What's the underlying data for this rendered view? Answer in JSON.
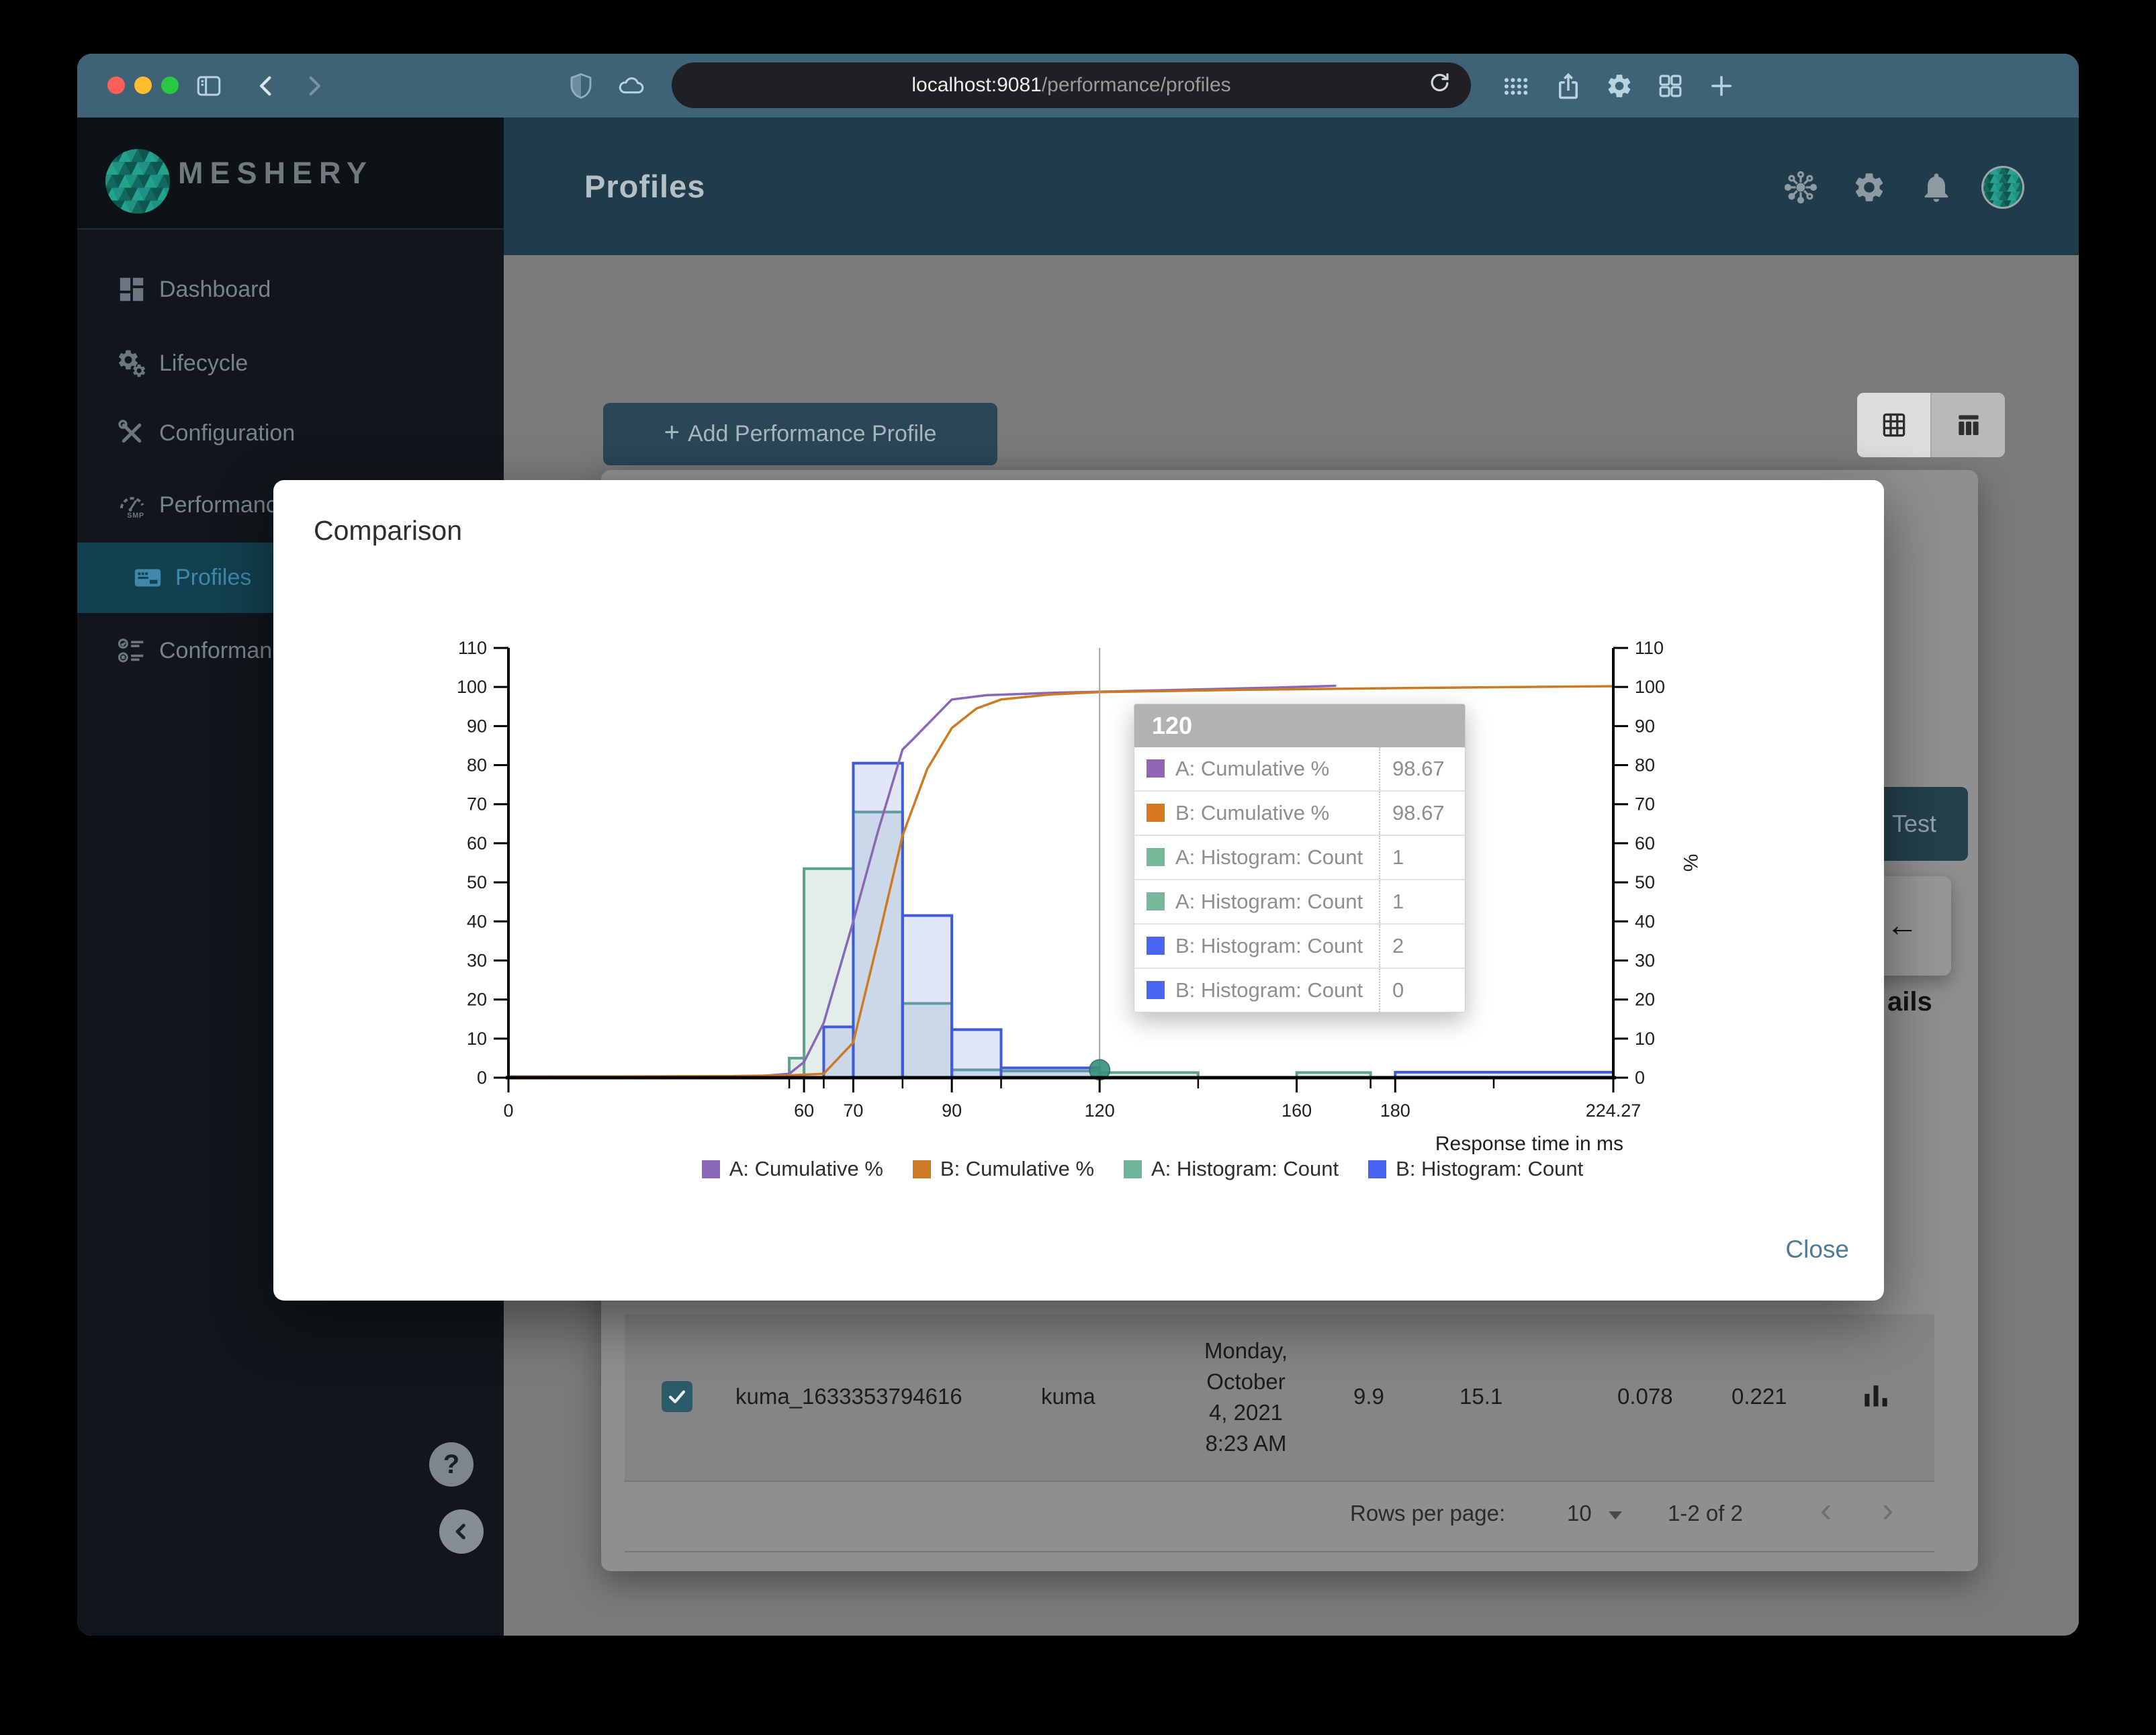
{
  "browser": {
    "url_host": "localhost:9081",
    "url_path": "/performance/profiles",
    "traffic_lights": [
      "#ff5f57",
      "#febc2e",
      "#28c840"
    ],
    "toolbar_icons": [
      "sidebar-toggle-icon",
      "back-icon",
      "forward-icon",
      "shield-icon",
      "cloud-icon",
      "reload-icon",
      "grid-dots-icon",
      "share-icon",
      "gear-icon",
      "tab-overview-icon",
      "new-tab-icon"
    ]
  },
  "sidebar": {
    "brand": "MESHERY",
    "items": [
      {
        "label": "Dashboard",
        "icon": "dashboard-icon",
        "active": false
      },
      {
        "label": "Lifecycle",
        "icon": "lifecycle-icon",
        "active": false
      },
      {
        "label": "Configuration",
        "icon": "configuration-icon",
        "active": false
      },
      {
        "label": "Performance",
        "icon": "performance-icon",
        "active": false
      },
      {
        "label": "Profiles",
        "icon": "profiles-icon",
        "active": true
      },
      {
        "label": "Conformance",
        "icon": "conformance-icon",
        "active": false
      }
    ],
    "help_label": "?"
  },
  "header": {
    "title": "Profiles",
    "icons": [
      "hub-icon",
      "gear-icon",
      "bell-icon",
      "avatar"
    ]
  },
  "content": {
    "add_button_label": "Add Performance Profile",
    "plus_glyph": "+",
    "test_button_label": "Test",
    "back_arrow_glyph": "←",
    "partial_heading": "ails",
    "table_row": {
      "name": "kuma_1633353794616",
      "mesh": "kuma",
      "date": "Monday,\nOctober\n4, 2021\n8:23 AM",
      "qps": "9.9",
      "duration": "15.1",
      "p50": "0.078",
      "p99": "0.221"
    },
    "pagination": {
      "rows_per_page_label": "Rows per page:",
      "rows_per_page_value": "10",
      "range_label": "1-2 of 2",
      "prev_glyph": "‹",
      "next_glyph": "›"
    }
  },
  "modal": {
    "title": "Comparison",
    "close_label": "Close"
  },
  "chart_data": {
    "type": "histogram+line",
    "title": "Comparison",
    "xlabel": "Response time in ms",
    "ylabel_right": "%",
    "xlim": [
      0,
      224.27
    ],
    "ylim": [
      0,
      110
    ],
    "y_ticks": [
      0,
      10,
      20,
      30,
      40,
      50,
      60,
      70,
      80,
      90,
      100,
      110
    ],
    "x_ticks_labeled": [
      "0",
      "60",
      "70",
      "90",
      "120",
      "160",
      "180",
      "224.27"
    ],
    "x_ticks_labeled_values": [
      0,
      60,
      70,
      90,
      120,
      160,
      180,
      224.27
    ],
    "x_ticks_minor": [
      57,
      64,
      80,
      100,
      140,
      175,
      200
    ],
    "grid": false,
    "series": [
      {
        "name": "A: Cumulative %",
        "type": "line",
        "color": "#8a67b7",
        "points": [
          [
            0,
            0.3
          ],
          [
            40,
            0.3
          ],
          [
            52,
            0.5
          ],
          [
            57,
            1
          ],
          [
            60,
            4
          ],
          [
            64,
            14
          ],
          [
            70,
            40
          ],
          [
            75,
            63
          ],
          [
            80,
            84
          ],
          [
            82,
            86.5
          ],
          [
            90,
            96.8
          ],
          [
            97,
            97.9
          ],
          [
            110,
            98.5
          ],
          [
            120,
            98.8
          ],
          [
            140,
            99.4
          ],
          [
            157,
            99.9
          ],
          [
            168,
            100.3
          ]
        ]
      },
      {
        "name": "B: Cumulative %",
        "type": "line",
        "color": "#cd7a25",
        "points": [
          [
            0,
            0.2
          ],
          [
            45,
            0.4
          ],
          [
            57,
            0.6
          ],
          [
            64,
            1
          ],
          [
            70,
            9
          ],
          [
            75,
            35
          ],
          [
            80,
            62
          ],
          [
            85,
            79
          ],
          [
            90,
            89.5
          ],
          [
            95,
            94.5
          ],
          [
            100,
            96.8
          ],
          [
            110,
            98.1
          ],
          [
            120,
            98.7
          ],
          [
            150,
            99.3
          ],
          [
            180,
            99.7
          ],
          [
            224.27,
            100.2
          ]
        ]
      },
      {
        "name": "A: Histogram: Count",
        "type": "histogram",
        "color": "#5fa28d",
        "fill": "rgba(127,178,158,0.22)",
        "bars": [
          [
            57,
            60,
            5
          ],
          [
            60,
            70,
            53.5
          ],
          [
            70,
            80,
            68
          ],
          [
            80,
            90,
            19
          ],
          [
            90,
            100,
            2
          ],
          [
            100,
            120,
            1.7
          ],
          [
            120,
            140,
            1.3
          ],
          [
            160,
            175,
            1.3
          ]
        ]
      },
      {
        "name": "B: Histogram: Count",
        "type": "histogram",
        "color": "#3f5bd9",
        "fill": "rgba(112,130,237,0.20)",
        "bars": [
          [
            64,
            70,
            13
          ],
          [
            70,
            80,
            80.5
          ],
          [
            80,
            90,
            41.5
          ],
          [
            90,
            100,
            12.3
          ],
          [
            100,
            120,
            2.5
          ],
          [
            180,
            224.27,
            1.4
          ]
        ]
      }
    ],
    "legend": [
      {
        "label": "A: Cumulative %",
        "color": "#8a67b7"
      },
      {
        "label": "B: Cumulative %",
        "color": "#cd7a25"
      },
      {
        "label": "A: Histogram: Count",
        "color": "#6fb699"
      },
      {
        "label": "B: Histogram: Count",
        "color": "#4a63ee"
      }
    ],
    "legend_position": "bottom",
    "crosshair_x": 120,
    "marker": {
      "x": 120,
      "y": 2,
      "color": "#37907c"
    },
    "tooltip": {
      "header": "120",
      "rows": [
        {
          "swatch": "#9265b4",
          "label": "A: Cumulative %",
          "value": "98.67"
        },
        {
          "swatch": "#d8771f",
          "label": "B: Cumulative %",
          "value": "98.67"
        },
        {
          "swatch": "#74b899",
          "label": "A: Histogram: Count",
          "value": "1"
        },
        {
          "swatch": "#74b899",
          "label": "A: Histogram: Count",
          "value": "1"
        },
        {
          "swatch": "#4a66f0",
          "label": "B: Histogram: Count",
          "value": "2"
        },
        {
          "swatch": "#4a66f0",
          "label": "B: Histogram: Count",
          "value": "0"
        }
      ]
    }
  }
}
